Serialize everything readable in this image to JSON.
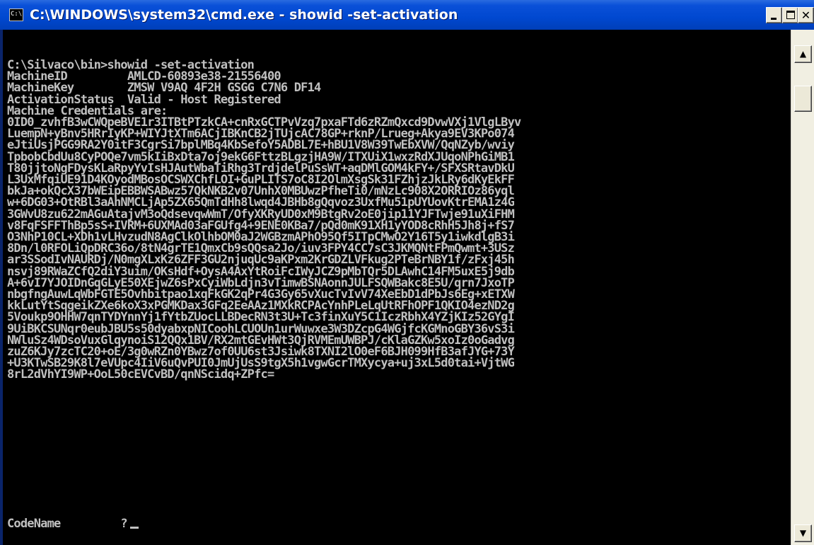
{
  "window": {
    "title": "C:\\WINDOWS\\system32\\cmd.exe - showid -set-activation",
    "icon": "cmd-icon",
    "icon_text": "C:\\",
    "controls": {
      "minimize": "minimize-icon",
      "maximize": "maximize-icon",
      "close": "close-icon",
      "close_glyph": "✕"
    }
  },
  "console": {
    "lines": [
      "C:\\Silvaco\\bin>showid -set-activation",
      "MachineID         AMLCD-60893e38-21556400",
      "MachineKey        ZMSW V9AQ 4F2H GSGG C7N6 DF14",
      "ActivationStatus  Valid - Host Registered",
      "Machine Credentials are:",
      "0ID0_zvhfB3wCWQpeBVE1r3ITBtPTzkCA+cnRxGCTPvVzq7pxaFTd6zRZmQxcd9DvwVXj1VlgLByv",
      "LuempN+yBnv5HRrIyKP+WIYJtXTm6ACjIBKnCB2jTUjcAC78GP+rknP/Lrueg+Akya9EV3KPo074",
      "eJtiUsjPGG9RA2Y0itF3CgrSi7bplMBq4KbSefoY5ADBL7E+hBU1V8W39TwEbXVW/QqNZyb/wviy",
      "TpbobCbdUu8CyPOQe7vm5kIiBxDta7oj9ekG6FttzBLgzjHA9W/ITXUiX1wxzRdXJUqoNPhGiMB1",
      "T80jjtoNgFDysKLaRpyYvIsHJAutWbaTiRhg3TrdjdelPuSsWT+aqDMlGOM4kFY+/SFXSRtavDkU",
      "L3UxMfqiUE91D4KOyodMBosOCSWXChfLOI+GuPLITS7oC8I2OlmXsgSk31FZhjzJkLRy6dKyEkFF",
      "bkJa+okQcX37bWEipEBBWSABwz57QkNKB2v07UnhX0MBUwzPfheTi0/mNzLc908X2ORRIOz86yql",
      "w+6DG03+OtRBl3aAhNMCLjAp5ZX65QmTdHh8lwqd4JBHb8gQqvoz3UxfMu51pUYUovKtrEMA1z4G",
      "3GWvU8zu622mAGuAtajvM3oQdsevqwWmT/OfyXKRyUD0xM9BtgRv2oE0jip11YJFTwje91uXiFHM",
      "v8FqFSFFThBp5sS+IVRM+6UXMAd03aFGUfg4+9ENE0KBa7/pQd0mK91XH1yYOD8cRhH5Jh8j+fS7",
      "O3NhP10CL+XDh1vLHvzudN8AgClkOlhbOM0aJ2WGBzmAPhO95Qf5ITpCMwO2Y16T5y1iwkdlgB3i",
      "8Dn/l0RFOLiQpDRC36o/8tN4grTE1QmxCb9sQQsa2Jo/iuv3FPY4CC7sC3JKMQNtFPmQwmt+3USz",
      "ar3SSodIvNAURDj/N0mgXLxKz6ZFF3GU2njuqUc9aKPxm2KrGDZLVFkug2PTeBrNBY1f/zFxj45h",
      "nsvj89RWaZCfQ2diY3uim/OKsHdf+OysA4AxYtRoiFcIWyJCZ9pMbTQr5DLAwhC14FM5uxE5j9db",
      "A+6vI7YJOIDnGqGLyE50XEjwZ6sPxCyiWbLdjn3vTimwBSNAonnJULFSQWBakc8E5U/qrn7JxoTP",
      "nbgfngAuwLqWbFGTE5Ovhbitpao1xqFkGK2qPr4G3Gy65vXucTvIvV74XeEbD1dPbJs6Eg+xETXW",
      "kkLutYtSqgeikZXe6koX3xPGMKDax3GFq2EeAAz1MXkRCPAcYnhPLeLqUtRFhOPF1QKIO4ezND2g",
      "5Voukp9OHHW7qnTYDYnnYj1fYtbZUocLLBDecRN3t3U+Tc3finXuY5C1IczRbhX4YZjKIz52GYgI",
      "9UiBKCSUNqr0eubJBU5s50dyabxpNICoohLCUOUn1urWuwxe3W3DZcpG4WGjfcKGMnoGBY36vS3i",
      "NWluSz4WDsoVuxGlqynoiS12QQx1BV/RX2mtGEvHWt3QjRVMEmUWBPJ/cKlaGZKw5xoIz0oGadvg",
      "zuZ6KJy7zcTC20+oE/3g0wRZn0YBwz7of0UU6st3Jsiwk8TXNI2lO0eF6BJH099HfB3afJYG+73Y",
      "+U3KTwSB29K8l7eVUpc4IiV6uQvPUI0JmUjUsS9tgX5h1vgwGcrTMXycya+uj3xL5d0tai+VjtWG",
      "8rL2dVhYI9WP+OoL50cEVCvBD/qnNScidq+ZPfc="
    ],
    "prompt_label": "CodeName",
    "prompt_mark": "?"
  },
  "scrollbar": {
    "up_icon": "scroll-up-arrow-icon",
    "down_icon": "scroll-down-arrow-icon",
    "up_glyph": "▲",
    "down_glyph": "▼"
  },
  "colors": {
    "title_bar": "#0048d0",
    "console_bg": "#000000",
    "console_text": "#c0c0c0"
  }
}
